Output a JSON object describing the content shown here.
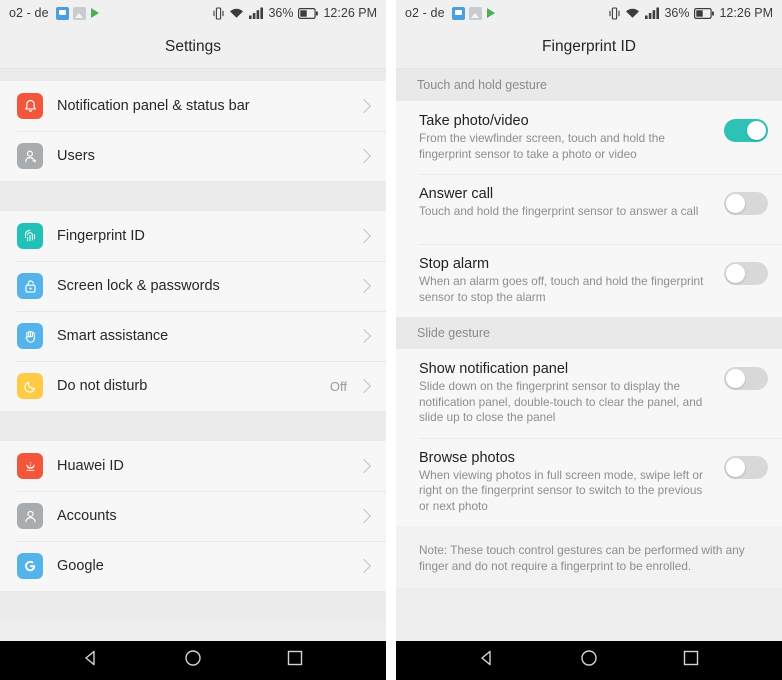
{
  "statusbar": {
    "carrier": "o2 - de",
    "battery_percent": "36%",
    "time": "12:26 PM",
    "app_icons": [
      "messaging-icon",
      "gallery-icon",
      "play-store-icon"
    ],
    "system_icons": [
      "vibrate-icon",
      "wifi-icon",
      "signal-icon",
      "battery-icon"
    ]
  },
  "left_screen": {
    "title": "Settings",
    "groups": [
      {
        "items": [
          {
            "label": "Notification panel & status bar",
            "icon": "bell-icon",
            "icon_color": "#f4563c",
            "value": ""
          },
          {
            "label": "Users",
            "icon": "user-icon",
            "icon_color": "#a9acae",
            "value": ""
          }
        ]
      },
      {
        "items": [
          {
            "label": "Fingerprint ID",
            "icon": "fingerprint-icon",
            "icon_color": "#21c1b8",
            "value": ""
          },
          {
            "label": "Screen lock & passwords",
            "icon": "lock-icon",
            "icon_color": "#55b3ec",
            "value": ""
          },
          {
            "label": "Smart assistance",
            "icon": "hand-icon",
            "icon_color": "#55b3ec",
            "value": ""
          },
          {
            "label": "Do not disturb",
            "icon": "moon-icon",
            "icon_color": "#ffcb47",
            "value": "Off"
          }
        ]
      },
      {
        "items": [
          {
            "label": "Huawei ID",
            "icon": "huawei-logo-icon",
            "icon_color": "#f4563c",
            "value": ""
          },
          {
            "label": "Accounts",
            "icon": "accounts-icon",
            "icon_color": "#a9acae",
            "value": ""
          },
          {
            "label": "Google",
            "icon": "google-logo-icon",
            "icon_color": "#55b3ec",
            "value": ""
          }
        ]
      }
    ]
  },
  "right_screen": {
    "title": "Fingerprint ID",
    "sections": [
      {
        "header": "Touch and hold gesture",
        "items": [
          {
            "title": "Take photo/video",
            "desc": "From the viewfinder screen, touch and hold the fingerprint sensor to take a photo or video",
            "toggle": "on"
          },
          {
            "title": "Answer call",
            "desc": "Touch and hold the fingerprint sensor to answer a call",
            "toggle": "off"
          },
          {
            "title": "Stop alarm",
            "desc": "When an alarm goes off, touch and hold the fingerprint sensor to stop the alarm",
            "toggle": "off"
          }
        ]
      },
      {
        "header": "Slide gesture",
        "items": [
          {
            "title": "Show notification panel",
            "desc": "Slide down on the fingerprint sensor to display the notification panel, double-touch to clear the panel, and slide up to close the panel",
            "toggle": "off"
          },
          {
            "title": "Browse photos",
            "desc": "When viewing photos in full screen mode, swipe left or right on the fingerprint sensor to switch to the previous or next photo",
            "toggle": "off"
          }
        ]
      }
    ],
    "note": "Note: These touch control gestures can be performed with any finger and do not require a fingerprint to be enrolled."
  },
  "navbar": {
    "buttons": [
      "back-button",
      "home-button",
      "recent-apps-button"
    ]
  },
  "colors": {
    "accent_on": "#2ec2b6",
    "toggle_off": "#d8d8d8",
    "list_bg": "#f7f7f7",
    "section_bg": "#e9e9e9"
  }
}
